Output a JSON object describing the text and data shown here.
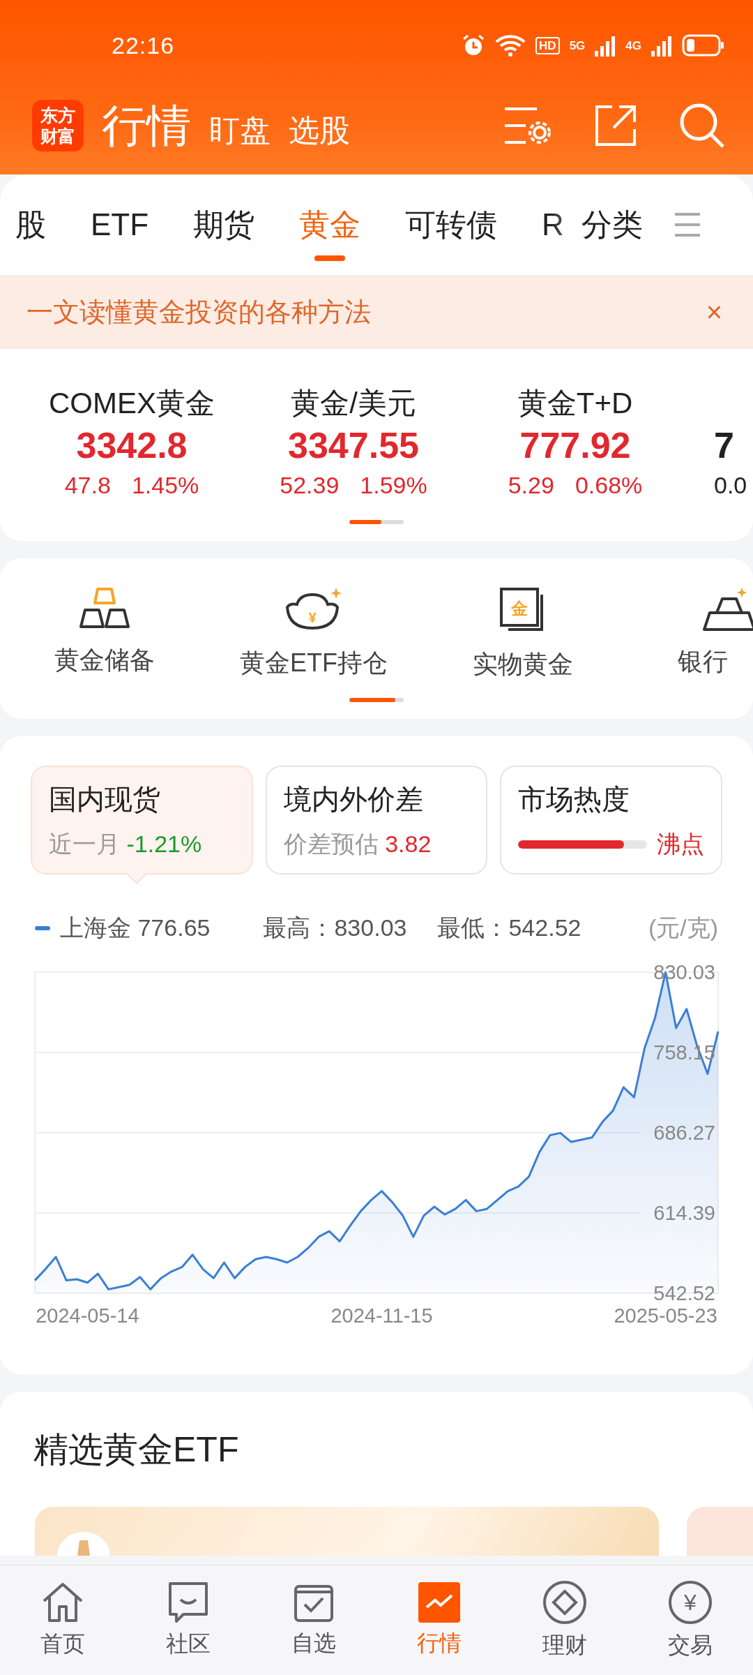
{
  "status_bar": {
    "time": "22:16",
    "network_labels": [
      "HD",
      "5G",
      "4G"
    ]
  },
  "header": {
    "logo": "东方财富",
    "title": "行情",
    "links": [
      "盯盘",
      "选股"
    ]
  },
  "tabs": [
    {
      "label": "股",
      "selected": false
    },
    {
      "label": "ETF",
      "selected": false
    },
    {
      "label": "期货",
      "selected": false
    },
    {
      "label": "黄金",
      "selected": true
    },
    {
      "label": "可转债",
      "selected": false
    },
    {
      "label": "R",
      "selected": false
    }
  ],
  "category_button": "分类",
  "banner": {
    "text": "一文读懂黄金投资的各种方法",
    "close": "×"
  },
  "quotes": [
    {
      "name": "COMEX黄金",
      "price": "3342.8",
      "change": "47.8",
      "percent": "1.45%",
      "color": "#e0282e"
    },
    {
      "name": "黄金/美元",
      "price": "3347.55",
      "change": "52.39",
      "percent": "1.59%",
      "color": "#e0282e"
    },
    {
      "name": "黄金T+D",
      "price": "777.92",
      "change": "5.29",
      "percent": "0.68%",
      "color": "#e0282e"
    },
    {
      "price": "7",
      "change": "0.0",
      "color": "#222222"
    }
  ],
  "shortcuts": [
    {
      "label": "黄金储备",
      "kind": "bars"
    },
    {
      "label": "黄金ETF持仓",
      "kind": "ingot",
      "glyph": "¥"
    },
    {
      "label": "实物黄金",
      "kind": "certificate",
      "glyph": "金"
    },
    {
      "label": "银行",
      "kind": "stack"
    }
  ],
  "metric_tabs": [
    {
      "title": "国内现货",
      "kind": "change",
      "caption": "近一月",
      "value": "-1.21%",
      "color": "#1a9b2e",
      "selected": true
    },
    {
      "title": "境内外价差",
      "kind": "change",
      "caption": "价差预估",
      "value": "3.82",
      "color": "#e0282e",
      "selected": false
    },
    {
      "title": "市场热度",
      "kind": "meter",
      "level": 0.82,
      "value": "沸点",
      "color": "#e0282e",
      "selected": false
    }
  ],
  "legend": {
    "value": "776.65",
    "high_label": "最高：",
    "high": "830.03",
    "low_label": "最低：",
    "low": "542.52",
    "unit": "(元/克)"
  },
  "chart": {
    "chart_data": {
      "type": "area",
      "series": [
        {
          "name": "上海金",
          "color": "#3a7fd5",
          "values": [
            554,
            564,
            575,
            554,
            555,
            552,
            560,
            546,
            548,
            550,
            557,
            546,
            556,
            562,
            566,
            577,
            564,
            556,
            570,
            556,
            566,
            573,
            575,
            573,
            570,
            575,
            583,
            593,
            598,
            589,
            603,
            616,
            626,
            634,
            624,
            612,
            593,
            612,
            620,
            613,
            618,
            626,
            616,
            618,
            626,
            634,
            638,
            647,
            669,
            684,
            686,
            678,
            680,
            682,
            696,
            706,
            727,
            718,
            762,
            789,
            830,
            780,
            797,
            764,
            739,
            777
          ]
        }
      ],
      "categories": [
        null,
        null,
        null,
        null,
        null,
        "2024-05-14",
        null,
        null,
        null,
        null,
        null,
        null,
        null,
        null,
        null,
        null,
        null,
        null,
        null,
        null,
        null,
        null,
        null,
        null,
        null,
        null,
        null,
        null,
        null,
        null,
        null,
        null,
        null,
        "2024-11-15",
        null,
        null,
        null,
        null,
        null,
        null,
        null,
        null,
        null,
        null,
        null,
        null,
        null,
        null,
        null,
        null,
        null,
        null,
        null,
        null,
        null,
        null,
        null,
        null,
        null,
        null,
        "2025-05-23",
        null,
        null,
        null,
        null,
        null
      ],
      "ylim": [
        542.52,
        830.03
      ],
      "grid": true,
      "yticks": [
        542.52,
        614.39,
        686.27,
        758.15,
        830.03
      ]
    }
  },
  "etf_section": {
    "title": "精选黄金ETF"
  },
  "bottom_nav": [
    {
      "label": "首页",
      "kind": "home",
      "selected": false
    },
    {
      "label": "社区",
      "kind": "chat",
      "selected": false
    },
    {
      "label": "自选",
      "kind": "check",
      "selected": false
    },
    {
      "label": "行情",
      "kind": "trend",
      "selected": true
    },
    {
      "label": "理财",
      "kind": "diamond",
      "selected": false
    },
    {
      "label": "交易",
      "kind": "coin",
      "glyph": "¥",
      "selected": false
    }
  ]
}
